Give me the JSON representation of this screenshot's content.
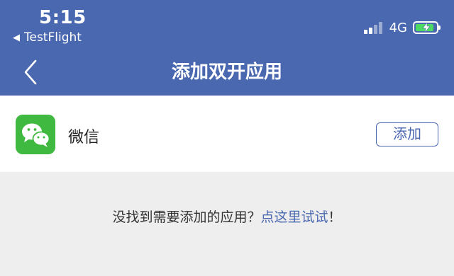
{
  "status_bar": {
    "time": "5:15",
    "back_app": "TestFlight",
    "network": "4G",
    "back_arrow_icon": "back-triangle-icon",
    "signal_icon": "signal-icon",
    "battery_icon": "battery-charging-icon",
    "battery_level": 0.78
  },
  "nav": {
    "title": "添加双开应用",
    "back_icon": "chevron-left-icon"
  },
  "apps": [
    {
      "name": "微信",
      "icon": "wechat-icon",
      "action_label": "添加"
    }
  ],
  "hint": {
    "text": "没找到需要添加的应用？",
    "link": "点这里试试",
    "suffix": "！"
  },
  "colors": {
    "header": "#4a68b0",
    "accent": "#4a68b0",
    "wechat": "#3fb93f",
    "battery_fill": "#4cd964",
    "background": "#eeeeee"
  }
}
